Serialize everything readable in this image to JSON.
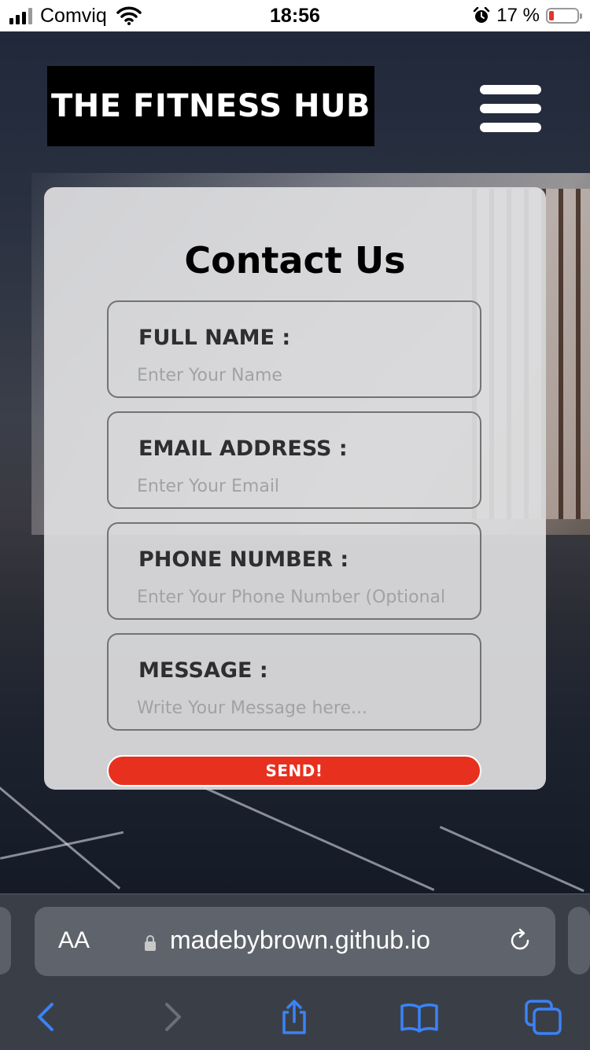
{
  "status_bar": {
    "carrier": "Comviq",
    "time": "18:56",
    "battery_percent_text": "17 %",
    "battery_level": 0.17,
    "icons": [
      "signal-icon",
      "wifi-icon",
      "alarm-icon",
      "battery-icon"
    ]
  },
  "header": {
    "logo": "THE FITNESS HUB",
    "menu_icon": "hamburger-menu-icon"
  },
  "contact_form": {
    "title": "Contact Us",
    "fields": [
      {
        "label": "FULL NAME :",
        "placeholder": "Enter Your Name",
        "value": ""
      },
      {
        "label": "EMAIL ADDRESS :",
        "placeholder": "Enter Your Email",
        "value": ""
      },
      {
        "label": "PHONE NUMBER :",
        "placeholder": "Enter Your Phone Number (Optional",
        "value": ""
      },
      {
        "label": "MESSAGE :",
        "placeholder": "Write Your Message here...",
        "value": ""
      }
    ],
    "submit_label": "SEND!"
  },
  "browser": {
    "text_size_label": "AA",
    "url": "madebybrown.github.io",
    "toolbar_icons": [
      "back-icon",
      "forward-icon",
      "share-icon",
      "bookmarks-icon",
      "tabs-icon"
    ]
  },
  "colors": {
    "send_button": "#e8301f",
    "browser_blue": "#3a82f7",
    "battery_low": "#e3342f"
  }
}
